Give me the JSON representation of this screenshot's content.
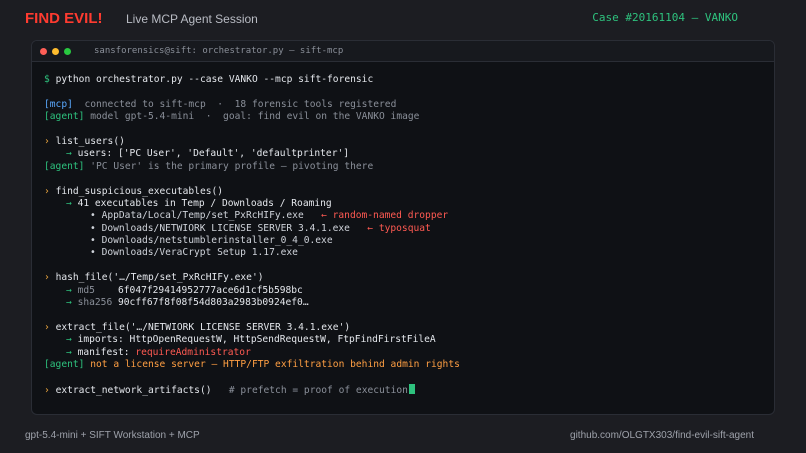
{
  "header": {
    "brand": "FIND EVIL!",
    "session": "Live MCP Agent Session",
    "case": "Case #20161104 — VANKO"
  },
  "terminal": {
    "title": "sansforensics@sift: orchestrator.py — sift-mcp",
    "prompt": "$",
    "command": "python orchestrator.py --case VANKO --mcp sift-forensic",
    "mcp_tag": "[mcp]",
    "mcp_msg": "  connected to sift-mcp  ·  18 forensic tools registered",
    "agent_tag": "[agent]",
    "agent_msg1": " model gpt-5.4-mini  ·  goal: find evil on the VANKO image",
    "call_marker": "›",
    "arrow": "→",
    "bullet": "•",
    "list_users": {
      "call": "list_users()",
      "result": "users: ['PC User', 'Default', 'defaultprinter']",
      "agent_note": " 'PC User' is the primary profile — pivoting there"
    },
    "find_exec": {
      "call": "find_suspicious_executables()",
      "result": "41 executables in Temp / Downloads / Roaming",
      "items": [
        {
          "text": "AppData/Local/Temp/set_PxRcHIFy.exe",
          "note": "random-named dropper"
        },
        {
          "text": "Downloads/NETWIORK LICENSE SERVER 3.4.1.exe",
          "note": "typosquat"
        },
        {
          "text": "Downloads/netstumblerinstaller_0_4_0.exe",
          "note": ""
        },
        {
          "text": "Downloads/VeraCrypt Setup 1.17.exe",
          "note": ""
        }
      ],
      "note_arrow": "←"
    },
    "hash_file": {
      "call": "hash_file('…/Temp/set_PxRcHIFy.exe')",
      "md5_label": "md5",
      "md5": "6f047f29414952777ace6d1cf5b598bc",
      "sha_label": "sha256",
      "sha": "90cff67f8f08f54d803a2983b0924ef0…"
    },
    "extract_file": {
      "call": "extract_file('…/NETWIORK LICENSE SERVER 3.4.1.exe')",
      "imports": "imports: HttpOpenRequestW, HttpSendRequestW, FtpFindFirstFileA",
      "manifest_label": "manifest: ",
      "manifest_value": "requireAdministrator",
      "agent_note": " not a license server — HTTP/FTP exfiltration behind admin rights"
    },
    "last_call": {
      "call": "extract_network_artifacts()",
      "comment": "   # prefetch = proof of execution"
    }
  },
  "footer": {
    "left": "gpt-5.4-mini  +  SIFT Workstation  +  MCP",
    "right": "github.com/OLGTX303/find-evil-sift-agent"
  }
}
